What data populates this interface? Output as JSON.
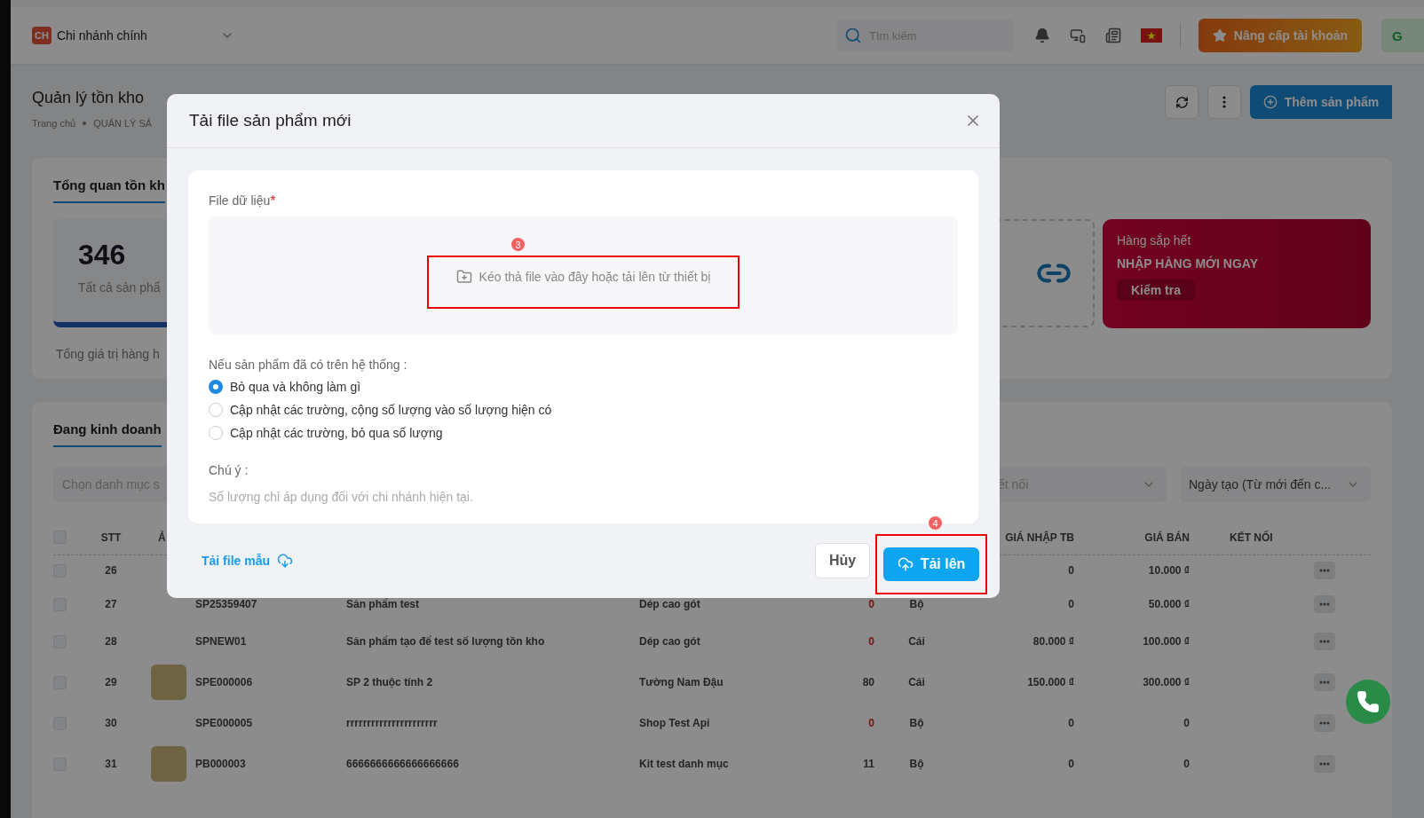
{
  "header": {
    "branch_badge": "CH",
    "branch": "Chi nhánh chính",
    "search_placeholder": "Tìm kiếm",
    "upgrade_button": "Nâng cấp tài khoản",
    "avatar": "G"
  },
  "page": {
    "title": "Quản lý tồn kho",
    "breadcrumb": [
      "Trang chủ",
      "QUẢN LÝ SẢ"
    ],
    "add_button": "Thêm sản phẩm"
  },
  "overview": {
    "tab": "Tổng quan tồn kh",
    "total": "346",
    "total_label": "Tất cả sản phẩ",
    "value_label": "Tổng giá trị hàng h",
    "alert": {
      "caption": "Hàng sắp hết",
      "headline": "NHẬP HÀNG MỚI NGAY",
      "button": "Kiểm tra"
    }
  },
  "products": {
    "tab": "Đang kinh doanh",
    "filters": [
      {
        "placeholder": "Chọn danh mục s"
      },
      {
        "placeholder": "ết nối"
      },
      {
        "value": "Ngày tạo (Từ mới đến c..."
      }
    ],
    "all_checked": false,
    "columns": [
      {
        "kind": "stt",
        "label": "STT"
      },
      {
        "kind": "image",
        "label": "Ả"
      },
      {
        "kind": "cost",
        "label": "GIÁ NHẬP TB"
      },
      {
        "kind": "price",
        "label": "GIÁ BÁN"
      },
      {
        "kind": "connection",
        "label": "KẾT NỐI"
      }
    ],
    "rows": [
      {
        "checked": false,
        "stt": "26",
        "has_photo": false,
        "cost": "0",
        "price": "10.000 ₫"
      },
      {
        "checked": false,
        "stt": "27",
        "has_photo": false,
        "sku": "SP25359407",
        "name": "Sản phẩm test",
        "category": "Dép cao gót",
        "qty": "0",
        "out_of_stock": true,
        "unit": "Bộ",
        "cost": "0",
        "price": "50.000 ₫"
      },
      {
        "checked": false,
        "stt": "28",
        "has_photo": false,
        "sku": "SPNEW01",
        "name": "Sản phẩm tạo để test số lượng tồn kho",
        "category": "Dép cao gót",
        "qty": "0",
        "out_of_stock": true,
        "unit": "Cái",
        "cost": "80.000 ₫",
        "price": "100.000 ₫"
      },
      {
        "checked": false,
        "stt": "29",
        "has_photo": true,
        "sku": "SPE000006",
        "name": "SP 2 thuộc tính 2",
        "category": "Tường Nam Đậu",
        "qty": "80",
        "out_of_stock": false,
        "unit": "Cái",
        "cost": "150.000 ₫",
        "price": "300.000 ₫"
      },
      {
        "checked": false,
        "stt": "30",
        "has_photo": false,
        "sku": "SPE000005",
        "name": "rrrrrrrrrrrrrrrrrrrrrr",
        "category": "Shop Test Api",
        "qty": "0",
        "out_of_stock": true,
        "unit": "Bộ",
        "cost": "0",
        "price": "0"
      },
      {
        "checked": false,
        "stt": "31",
        "has_photo": true,
        "sku": "PB000003",
        "name": "6666666666666666666",
        "category": "Kit test danh mục",
        "qty": "11",
        "out_of_stock": false,
        "unit": "Bộ",
        "cost": "0",
        "price": "0"
      }
    ]
  },
  "modal": {
    "title": "Tải file sản phẩm mới",
    "file_label": "File dữ liệu",
    "required_mark": "*",
    "dropzone_prompt": "Kéo thả file vào đây hoặc tải lên từ thiết bị",
    "duplicate_label": "Nếu sản phẩm đã có trên hệ thống :",
    "options": [
      {
        "label": "Bỏ qua và không làm gì",
        "selected": true
      },
      {
        "label": "Cập nhật các trường, cộng số lượng vào số lượng hiện có",
        "selected": false
      },
      {
        "label": "Cập nhật các trường, bỏ qua số lượng",
        "selected": false
      }
    ],
    "note_label": "Chú ý :",
    "note": "Số lượng chỉ áp dụng đối với chi nhánh hiện tại.",
    "template_link": "Tải file mẫu",
    "cancel_button": "Hủy",
    "upload_button": "Tải lên"
  },
  "annotations": [
    {
      "number": "3"
    },
    {
      "number": "4"
    }
  ]
}
